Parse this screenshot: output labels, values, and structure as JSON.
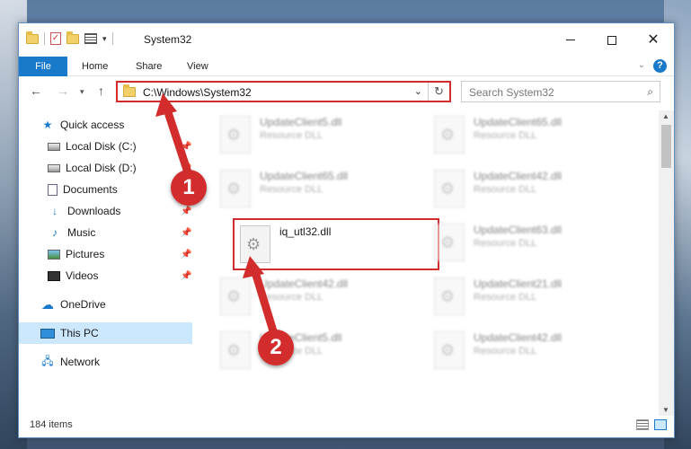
{
  "window": {
    "title": "System32"
  },
  "ribbon": {
    "tabs": [
      "File",
      "Home",
      "Share",
      "View"
    ]
  },
  "address": {
    "path": "C:\\Windows\\System32"
  },
  "search": {
    "placeholder": "Search System32"
  },
  "sidebar": {
    "items": [
      {
        "label": "Quick access",
        "icon": "star-icon",
        "pinned": false
      },
      {
        "label": "Local Disk (C:)",
        "icon": "drive-icon",
        "pinned": true
      },
      {
        "label": "Local Disk (D:)",
        "icon": "drive-icon",
        "pinned": true
      },
      {
        "label": "Documents",
        "icon": "documents-icon",
        "pinned": true
      },
      {
        "label": "Downloads",
        "icon": "downloads-icon",
        "pinned": true
      },
      {
        "label": "Music",
        "icon": "music-icon",
        "pinned": true
      },
      {
        "label": "Pictures",
        "icon": "pictures-icon",
        "pinned": true
      },
      {
        "label": "Videos",
        "icon": "videos-icon",
        "pinned": true
      },
      {
        "label": "OneDrive",
        "icon": "cloud-icon",
        "pinned": false
      },
      {
        "label": "This PC",
        "icon": "pc-icon",
        "pinned": false,
        "selected": true
      },
      {
        "label": "Network",
        "icon": "network-icon",
        "pinned": false
      }
    ]
  },
  "files": [
    {
      "name": "UpdateClient5.dll",
      "type": "Resource DLL"
    },
    {
      "name": "UpdateClient65.dll",
      "type": "Resource DLL"
    },
    {
      "name": "UpdateClient65.dll",
      "type": "Resource DLL"
    },
    {
      "name": "UpdateClient42.dll",
      "type": "Resource DLL"
    },
    {
      "name": "iq_utl32.dll",
      "type": ""
    },
    {
      "name": "UpdateClient63.dll",
      "type": "Resource DLL"
    },
    {
      "name": "UpdateClient42.dll",
      "type": "Resource DLL"
    },
    {
      "name": "UpdateClient21.dll",
      "type": "Resource DLL"
    },
    {
      "name": "UpdateClient5.dll",
      "type": "Resource DLL"
    },
    {
      "name": "UpdateClient42.dll",
      "type": "Resource DLL"
    }
  ],
  "status": {
    "item_count": "184 items"
  },
  "annotations": {
    "marker1": "1",
    "marker2": "2"
  },
  "colors": {
    "accent": "#1979ca",
    "highlight": "#d32c2c",
    "selected_bg": "#cce8ff"
  }
}
